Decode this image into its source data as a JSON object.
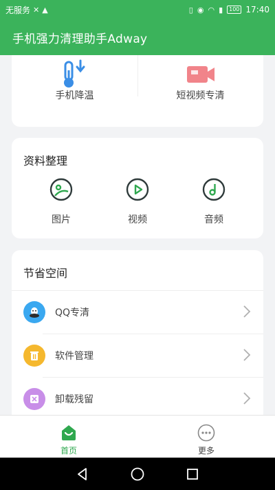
{
  "status_bar": {
    "carrier": "无服务",
    "time": "17:40",
    "battery": "100"
  },
  "app_bar": {
    "title": "手机强力清理助手Adway"
  },
  "tools": [
    {
      "label": "手机降温",
      "icon": "thermometer-icon"
    },
    {
      "label": "短视频专清",
      "icon": "video-camera-icon"
    }
  ],
  "data_section": {
    "title": "资料整理",
    "items": [
      {
        "label": "图片",
        "icon": "image-icon"
      },
      {
        "label": "视频",
        "icon": "play-icon"
      },
      {
        "label": "音频",
        "icon": "music-icon"
      }
    ]
  },
  "space_section": {
    "title": "节省空间",
    "items": [
      {
        "label": "QQ专清",
        "icon": "qq-icon",
        "color": "#3aa8f0"
      },
      {
        "label": "软件管理",
        "icon": "trash-icon",
        "color": "#f5b82e"
      },
      {
        "label": "卸载残留",
        "icon": "uninstall-icon",
        "color": "#c88ee8"
      }
    ]
  },
  "bottom_nav": {
    "home": "首页",
    "more": "更多",
    "active_color": "#2fa84f"
  }
}
